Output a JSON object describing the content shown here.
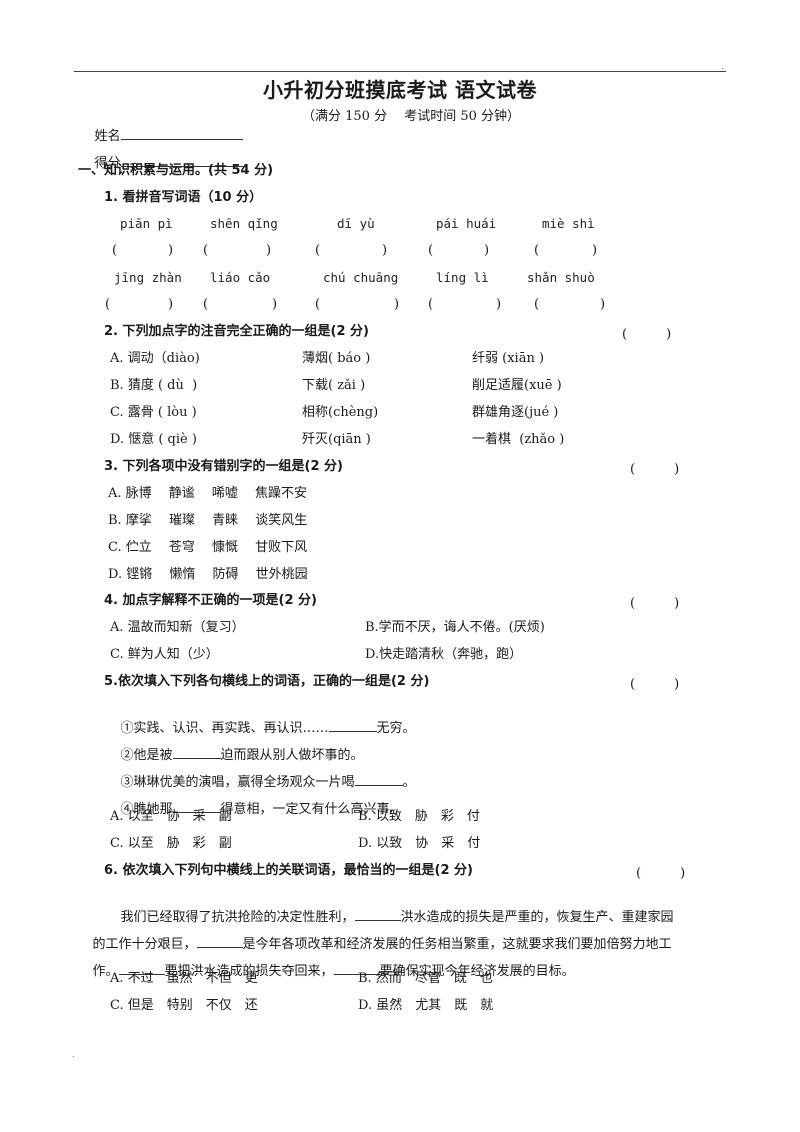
{
  "document": {
    "title": "小升初分班摸底考试 语文试卷",
    "name_label": "姓名",
    "score_label": "得分",
    "meta": "（满分 150 分　 考试时间 50 分钟）",
    "section1": "一、知识积累与运用。(共 54 分)",
    "answer_paren": "(　　　)"
  },
  "q1": {
    "title": "1. 看拼音写词语（10 分）",
    "row1": [
      "piān pì",
      "shēn qǐng",
      "dī yù",
      "pái huái",
      "miè shì"
    ],
    "row2": [
      "jīng zhàn",
      "liáo cǎo",
      "chú chuāng",
      "líng lì",
      "shǎn shuò"
    ],
    "blank_paren_left": "(",
    "blank_paren_right": ")"
  },
  "q2": {
    "title": "2. 下列加点字的注音完全正确的一组是(2 分)",
    "options": [
      [
        "A. 调动（diào)",
        "薄烟( báo )",
        "纤弱 (xiān )"
      ],
      [
        "B. 猜度 ( dù  )",
        "下载( zǎi )",
        "削足适履(xuē )"
      ],
      [
        "C. 露骨 ( lòu )",
        "相称(chèng)",
        "群雄角逐(jué )"
      ],
      [
        "D. 惬意 ( qiè )",
        "歼灭(qiān )",
        "一着棋  (zhǎo )"
      ]
    ]
  },
  "q3": {
    "title": "3. 下列各项中没有错别字的一组是(2 分)",
    "options": [
      "A. 脉博　 静谧　 唏嘘　 焦躁不安",
      "B. 摩挲　 璀璨　 青睐　 谈笑风生",
      "C. 伫立　 苍穹　 慷慨　 甘败下风",
      "D. 铿锵　 懒惰　 防碍　 世外桃园"
    ]
  },
  "q4": {
    "title": "4. 加点字解释不正确的一项是(2 分)",
    "options": [
      [
        "A. 温故而知新（复习）",
        "B.学而不厌，诲人不倦。(厌烦)"
      ],
      [
        "C. 鲜为人知（少）",
        "D.快走踏清秋（奔驰，跑）"
      ]
    ]
  },
  "q5": {
    "title": "5.依次填入下列各句横线上的词语，正确的一组是(2 分)",
    "sentences": [
      {
        "before": "①实践、认识、再实践、再认识……",
        "after": "无穷。"
      },
      {
        "before": "②他是被",
        "after": "迫而跟从别人做坏事的。"
      },
      {
        "before": "③琳琳优美的演唱，赢得全场观众一片喝",
        "after": "。"
      },
      {
        "before": "④瞧她那",
        "after": "得意相，一定又有什么高兴事。"
      }
    ],
    "options": [
      [
        "A. 以至　协　采　副",
        "B. 以致　胁　彩　付"
      ],
      [
        "C. 以至　胁　彩　副",
        "D. 以致　协　采　付"
      ]
    ]
  },
  "q6": {
    "title": "6. 依次填入下列句中横线上的关联词语，最恰当的一组是(2 分)",
    "passage": {
      "l1a": "我们已经取得了抗洪抢险的决定性胜利，",
      "l1b": "洪水造成的损失是严重的，恢复生产、重建家园",
      "l2a": "的工作十分艰巨，",
      "l2b": "是今年各项改革和经济发展的任务相当繁重，这就要求我们要加倍努力地工",
      "l3a": "作。",
      "l3b": "要把洪水造成的损失夺回来，",
      "l3c": "要确保实现今年经济发展的目标。"
    },
    "options": [
      [
        "A. 不过　虽然　不但　更",
        "B. 然而　尽管　既　也"
      ],
      [
        "C. 但是　特别　不仅　还",
        "D. 虽然　尤其　既　就"
      ]
    ]
  }
}
